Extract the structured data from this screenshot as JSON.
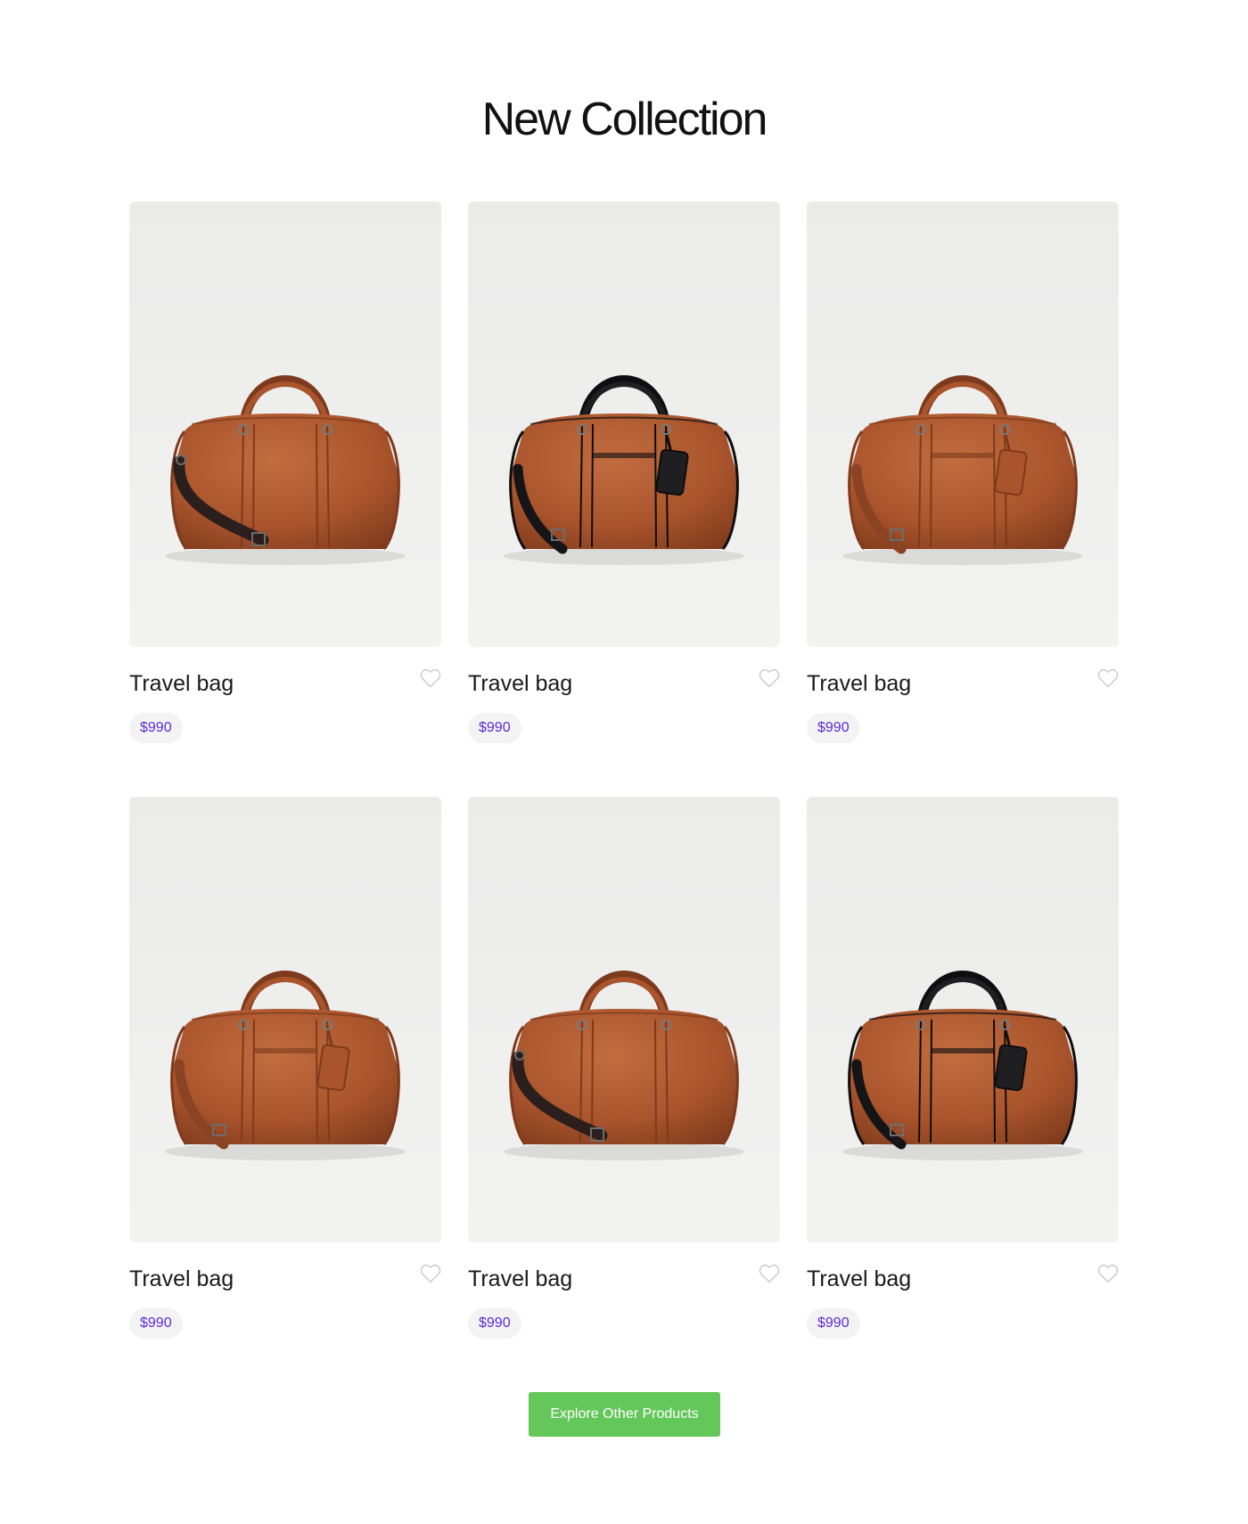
{
  "section": {
    "title": "New Collection"
  },
  "colors": {
    "price_text": "#5b2bd6",
    "price_badge_bg": "#f3f3f4",
    "button_bg": "#64c75a",
    "image_bg": "#ebebea",
    "bag_brown": "#a9542c",
    "bag_black": "#1f1f21"
  },
  "products": [
    {
      "name": "Travel bag",
      "price": "$990",
      "bag_color": "brown",
      "image": "brown duffel bag with shoulder strap",
      "favorite_icon": "heart-outline-icon"
    },
    {
      "name": "Travel bag",
      "price": "$990",
      "bag_color": "black",
      "image": "black duffel bag with luggage tag",
      "favorite_icon": "heart-outline-icon"
    },
    {
      "name": "Travel bag",
      "price": "$990",
      "bag_color": "brown",
      "image": "brown duffel bag with luggage tag",
      "favorite_icon": "heart-outline-icon"
    },
    {
      "name": "Travel bag",
      "price": "$990",
      "bag_color": "brown",
      "image": "brown duffel bag with luggage tag",
      "favorite_icon": "heart-outline-icon"
    },
    {
      "name": "Travel bag",
      "price": "$990",
      "bag_color": "brown",
      "image": "brown duffel bag with shoulder strap",
      "favorite_icon": "heart-outline-icon"
    },
    {
      "name": "Travel bag",
      "price": "$990",
      "bag_color": "black",
      "image": "black duffel bag with luggage tag",
      "favorite_icon": "heart-outline-icon"
    }
  ],
  "cta": {
    "label": "Explore Other Products"
  }
}
